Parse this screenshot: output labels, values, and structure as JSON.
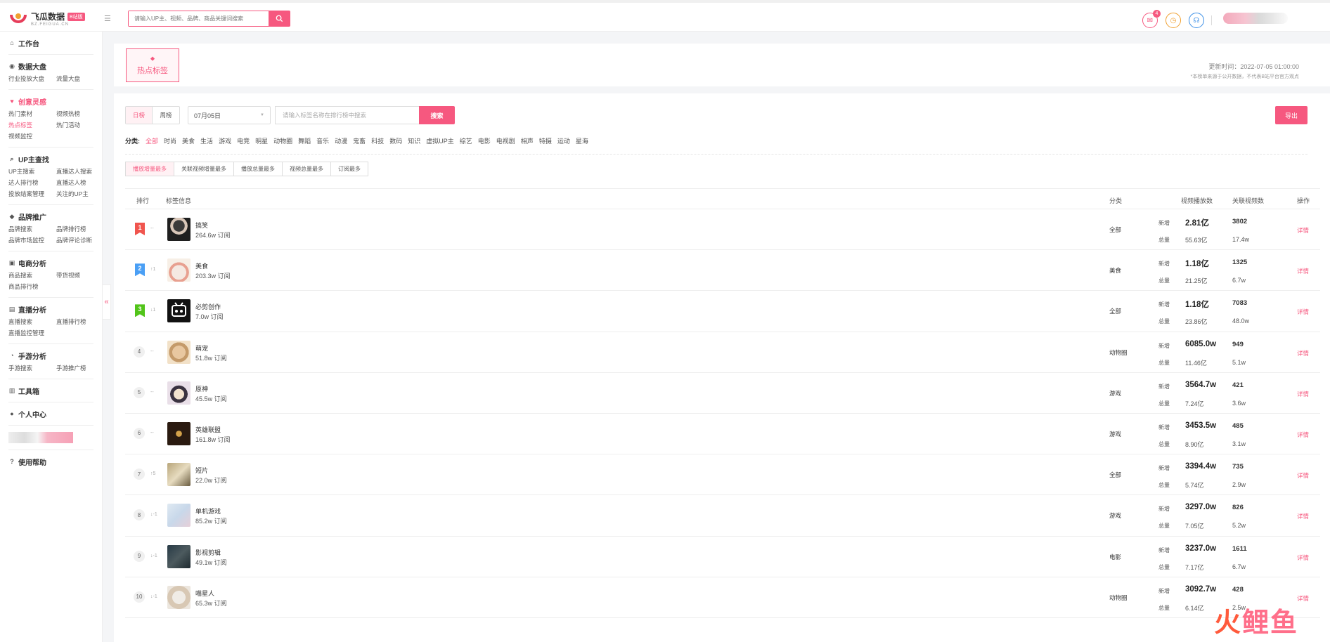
{
  "app": {
    "name": "飞瓜数据",
    "badge": "B站版",
    "sub": "BZ.FEIGUA.CN"
  },
  "header": {
    "search_placeholder": "请输入UP主、视频、品牌、商品关键词搜索",
    "notif_count": "4"
  },
  "sidebar": {
    "workbench": "工作台",
    "sections": [
      {
        "title": "数据大盘",
        "items": [
          "行业投放大盘",
          "流量大盘"
        ]
      },
      {
        "title": "创意灵感",
        "items": [
          "热门素材",
          "视频热榜",
          "热点标签",
          "热门活动",
          "视频监控"
        ]
      },
      {
        "title": "UP主查找",
        "items": [
          "UP主搜索",
          "直播达人搜索",
          "达人排行榜",
          "直播达人榜",
          "投放结案管理",
          "关注的UP主"
        ]
      },
      {
        "title": "品牌推广",
        "items": [
          "品牌搜索",
          "品牌排行榜",
          "品牌市场监控",
          "品牌评论诊断"
        ]
      },
      {
        "title": "电商分析",
        "items": [
          "商品搜索",
          "带货视频",
          "商品排行榜"
        ]
      },
      {
        "title": "直播分析",
        "items": [
          "直播搜索",
          "直播排行榜",
          "直播监控管理"
        ]
      },
      {
        "title": "手游分析",
        "items": [
          "手游搜索",
          "手游推广榜"
        ]
      }
    ],
    "toolbox": "工具箱",
    "personal": "个人中心",
    "help": "使用帮助"
  },
  "page": {
    "tag_label": "热点标签",
    "update_time": "更新时间：2022-07-05 01:00:00",
    "update_note": "*本榜单来源于公开数据，不代表B站平台官方观点"
  },
  "controls": {
    "daily": "日榜",
    "weekly": "周榜",
    "date": "07月05日",
    "search_placeholder": "请输入标签名称在排行榜中搜索",
    "search_btn": "搜索",
    "export": "导出"
  },
  "categories": {
    "label": "分类:",
    "items": [
      "全部",
      "时尚",
      "美食",
      "生活",
      "游戏",
      "电竞",
      "明星",
      "动物圈",
      "舞蹈",
      "音乐",
      "动漫",
      "鬼畜",
      "科技",
      "数码",
      "知识",
      "虚拟UP主",
      "综艺",
      "电影",
      "电视剧",
      "相声",
      "特摄",
      "运动",
      "星海"
    ]
  },
  "sort_tabs": [
    "播放增量最多",
    "关联视频增量最多",
    "播放总量最多",
    "视频总量最多",
    "订阅最多"
  ],
  "table": {
    "headers": {
      "rank": "排行",
      "info": "标签信息",
      "category": "分类",
      "plays": "视频播放数",
      "videos": "关联视频数",
      "op": "操作"
    },
    "new_label": "新增",
    "total_label": "总量",
    "detail_label": "详情",
    "rows": [
      {
        "rank": "1",
        "change": "--",
        "name": "搞笑",
        "subs": "264.6w 订阅",
        "cat": "全部",
        "pv_new": "2.81亿",
        "pv_tot": "55.63亿",
        "vc_new": "3802",
        "vc_tot": "17.4w"
      },
      {
        "rank": "2",
        "change": "↑1",
        "name": "美食",
        "subs": "203.3w 订阅",
        "cat": "美食",
        "pv_new": "1.18亿",
        "pv_tot": "21.25亿",
        "vc_new": "1325",
        "vc_tot": "6.7w"
      },
      {
        "rank": "3",
        "change": "↓1",
        "name": "必剪创作",
        "subs": "7.0w 订阅",
        "cat": "全部",
        "pv_new": "1.18亿",
        "pv_tot": "23.86亿",
        "vc_new": "7083",
        "vc_tot": "48.0w"
      },
      {
        "rank": "4",
        "change": "--",
        "name": "萌宠",
        "subs": "51.8w 订阅",
        "cat": "动物圈",
        "pv_new": "6085.0w",
        "pv_tot": "11.46亿",
        "vc_new": "949",
        "vc_tot": "5.1w"
      },
      {
        "rank": "5",
        "change": "--",
        "name": "原神",
        "subs": "45.5w 订阅",
        "cat": "游戏",
        "pv_new": "3564.7w",
        "pv_tot": "7.24亿",
        "vc_new": "421",
        "vc_tot": "3.6w"
      },
      {
        "rank": "6",
        "change": "--",
        "name": "英雄联盟",
        "subs": "161.8w 订阅",
        "cat": "游戏",
        "pv_new": "3453.5w",
        "pv_tot": "8.90亿",
        "vc_new": "485",
        "vc_tot": "3.1w"
      },
      {
        "rank": "7",
        "change": "↑5",
        "name": "短片",
        "subs": "22.0w 订阅",
        "cat": "全部",
        "pv_new": "3394.4w",
        "pv_tot": "5.74亿",
        "vc_new": "735",
        "vc_tot": "2.9w"
      },
      {
        "rank": "8",
        "change": "↓-1",
        "name": "单机游戏",
        "subs": "85.2w 订阅",
        "cat": "游戏",
        "pv_new": "3297.0w",
        "pv_tot": "7.05亿",
        "vc_new": "826",
        "vc_tot": "5.2w"
      },
      {
        "rank": "9",
        "change": "↓-1",
        "name": "影视剪辑",
        "subs": "49.1w 订阅",
        "cat": "电影",
        "pv_new": "3237.0w",
        "pv_tot": "7.17亿",
        "vc_new": "1611",
        "vc_tot": "6.7w"
      },
      {
        "rank": "10",
        "change": "↓-1",
        "name": "喵星人",
        "subs": "65.3w 订阅",
        "cat": "动物圈",
        "pv_new": "3092.7w",
        "pv_tot": "6.14亿",
        "vc_new": "428",
        "vc_tot": "2.5w"
      }
    ]
  },
  "watermark": {
    "a": "火",
    "b": "鲤鱼"
  },
  "colors": {
    "accent": "#f6587f",
    "rank1": "#f0554e",
    "rank2": "#4a9ff5",
    "rank3": "#52c41a"
  }
}
